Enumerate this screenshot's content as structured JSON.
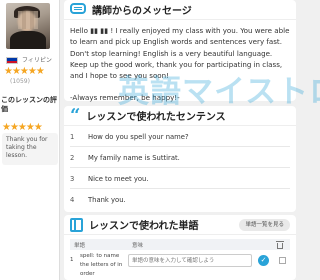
{
  "teacher": {
    "country": "フィリピン",
    "rating_stars": "★★★★★",
    "review_count": "(1059)",
    "evaluation_heading": "このレッスンの評価",
    "lesson_rating_stars": "★★★★★",
    "lesson_comment": "Thank you for taking the lesson."
  },
  "message": {
    "title": "講師からのメッセージ",
    "body": "Hello ▮▮ ▮▮ ! I really enjoyed my class with you. You were able to learn and pick up English words and sentences very fast. Don't stop learning! English is a very beautiful language. Keep up the good work, thank you for participating in class, and I hope to see you soon!",
    "signoff": "-Always remember, be happy!-"
  },
  "sentences": {
    "title": "レッスンで使われたセンテンス",
    "items": [
      {
        "no": "1",
        "text": "How do you spell your name?"
      },
      {
        "no": "2",
        "text": "My family name is Suttirat."
      },
      {
        "no": "3",
        "text": "Nice to meet you."
      },
      {
        "no": "4",
        "text": "Thank you."
      }
    ]
  },
  "words": {
    "title": "レッスンで使われた単語",
    "add_button": "単語一覧を見る",
    "col_word": "単語",
    "col_meaning": "意味",
    "rows": [
      {
        "no": "1",
        "word": "spell: to name the letters of in order",
        "placeholder": "単語の意味を入力して確認しよう"
      }
    ]
  },
  "watermark": "英語マイストロ",
  "colors": {
    "accent": "#29a3d8",
    "star": "#f5a623"
  }
}
